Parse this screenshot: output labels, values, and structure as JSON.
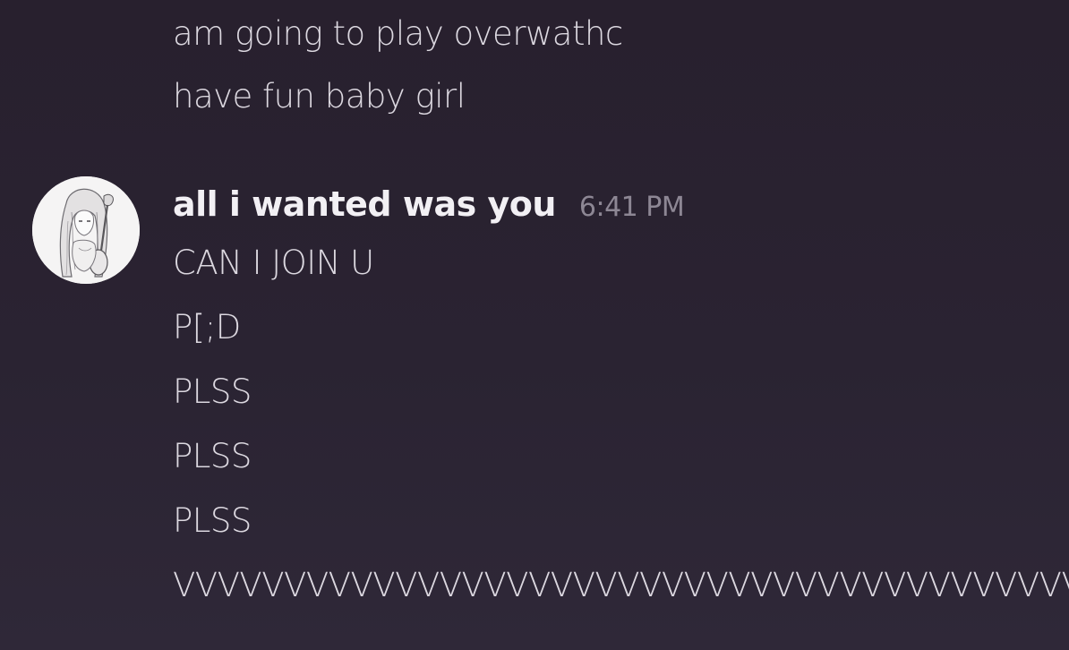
{
  "previous_messages": [
    "am going to play overwathc",
    "have fun baby girl"
  ],
  "group": {
    "username": "all i wanted was you",
    "timestamp": "6:41 PM",
    "avatar_icon": "anime-girl-avatar-icon",
    "messages": [
      "CAN I JOIN U",
      "P[;D",
      "PLSS",
      "PLSS",
      "PLSS",
      "VVVVVVVVVVVVVVVVVVVVVVVVVVVVVVVVVVVVVVVVV"
    ]
  },
  "colors": {
    "background": "#2a2332",
    "message_text": "#dcd8e0",
    "username": "#f2f0f4",
    "timestamp": "#8d8794"
  }
}
